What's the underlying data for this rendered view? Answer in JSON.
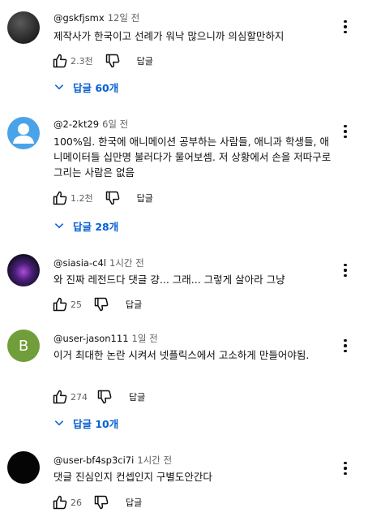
{
  "reply_label": "답글",
  "comments": [
    {
      "author": "@gskfjsmx",
      "time": "12일 전",
      "text": "제작사가 한국이고 선례가 워낙 많으니까 의심할만하지",
      "likes": "2.3천",
      "replies": "답글 60개"
    },
    {
      "author": "@2-2kt29",
      "time": "6일 전",
      "text": "100%임. 한국에 애니메이션 공부하는 사람들, 애니과 학생들, 애니메이터들 십만명 불러다가 물어보셈. 저 상황에서 손을 저따구로 그리는 사람은 없음",
      "likes": "1.2천",
      "replies": "답글 28개"
    },
    {
      "author": "@siasia-c4l",
      "time": "1시간 전",
      "text": "와 진짜 레전드다 댓글 걍... 그래... 그렇게 살아라 그냥",
      "likes": "25"
    },
    {
      "author": "@user-jason111",
      "time": "1일 전",
      "text": "이거 최대한 논란 시켜서 넷플릭스에서 고소하게 만들어야됨.",
      "likes": "274",
      "replies": "답글 10개",
      "avatar_letter": "B"
    },
    {
      "author": "@user-bf4sp3ci7i",
      "time": "1시간 전",
      "text": "댓글 진심인지 컨셉인지 구별도안간다",
      "likes": "26"
    }
  ]
}
